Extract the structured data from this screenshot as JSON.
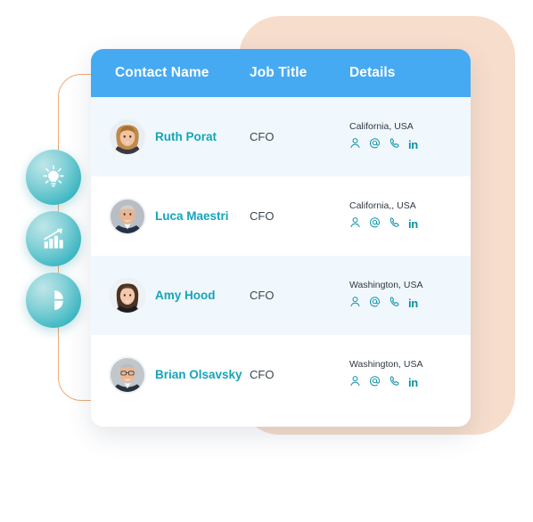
{
  "table": {
    "columns": [
      {
        "key": "contact_name",
        "label": "Contact Name"
      },
      {
        "key": "job_title",
        "label": "Job Title"
      },
      {
        "key": "details",
        "label": "Details"
      }
    ],
    "header_bg": "#45aaf2",
    "header_text_color": "#ffffff",
    "row_tint_color": "#f1f8fd",
    "name_color": "#13a5b8",
    "rows": [
      {
        "name": "Ruth Porat",
        "job_title": "CFO",
        "location": "California, USA",
        "tinted": true,
        "avatar_id": "avatar-ruth-porat",
        "detail_icons": [
          "contact-person-icon",
          "email-at-icon",
          "phone-icon",
          "linkedin-icon"
        ]
      },
      {
        "name": "Luca Maestri",
        "job_title": "CFO",
        "location": "California,, USA",
        "tinted": false,
        "avatar_id": "avatar-luca-maestri",
        "detail_icons": [
          "contact-person-icon",
          "email-at-icon",
          "phone-icon",
          "linkedin-icon"
        ]
      },
      {
        "name": "Amy Hood",
        "job_title": "CFO",
        "location": "Washington, USA",
        "tinted": true,
        "avatar_id": "avatar-amy-hood",
        "detail_icons": [
          "contact-person-icon",
          "email-at-icon",
          "phone-icon",
          "linkedin-icon"
        ]
      },
      {
        "name": "Brian Olsavsky",
        "job_title": "CFO",
        "location": "Washington, USA",
        "tinted": false,
        "avatar_id": "avatar-brian-olsavsky",
        "detail_icons": [
          "contact-person-icon",
          "email-at-icon",
          "phone-icon",
          "linkedin-icon"
        ]
      }
    ]
  },
  "badges": [
    {
      "icon": "lightbulb-icon"
    },
    {
      "icon": "bar-chart-growth-icon"
    },
    {
      "icon": "pie-chart-icon"
    }
  ],
  "decoration": {
    "peach_color": "#f7ddcc",
    "orange_outline_color": "#f0a875",
    "badge_gradient_from": "#bfe6e8",
    "badge_gradient_to": "#16a7b4",
    "detail_icon_color": "#0b8fa8"
  },
  "linkedin_glyph": "in"
}
